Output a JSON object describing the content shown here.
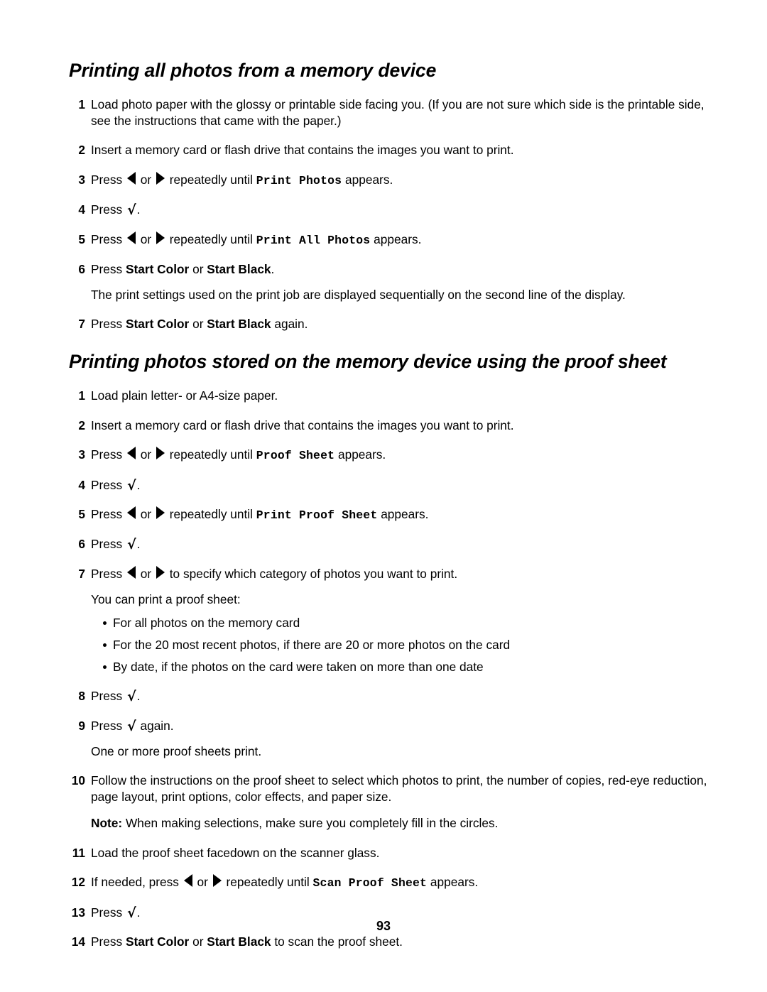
{
  "document": {
    "page_number": "93",
    "sections": [
      {
        "heading": "Printing all photos from a memory device",
        "steps": [
          {
            "num": "1",
            "parts": [
              {
                "t": "text",
                "v": "Load photo paper with the glossy or printable side facing you. (If you are not sure which side is the printable side, see the instructions that came with the paper.)"
              }
            ]
          },
          {
            "num": "2",
            "parts": [
              {
                "t": "text",
                "v": "Insert a memory card or flash drive that contains the images you want to print."
              }
            ]
          },
          {
            "num": "3",
            "parts": [
              {
                "t": "text",
                "v": "Press "
              },
              {
                "t": "icon",
                "v": "arrow-left"
              },
              {
                "t": "text",
                "v": " or "
              },
              {
                "t": "icon",
                "v": "arrow-right"
              },
              {
                "t": "text",
                "v": " repeatedly until "
              },
              {
                "t": "lcd",
                "v": "Print Photos"
              },
              {
                "t": "text",
                "v": " appears."
              }
            ]
          },
          {
            "num": "4",
            "parts": [
              {
                "t": "text",
                "v": "Press "
              },
              {
                "t": "icon",
                "v": "checkmark"
              },
              {
                "t": "text",
                "v": "."
              }
            ]
          },
          {
            "num": "5",
            "parts": [
              {
                "t": "text",
                "v": "Press "
              },
              {
                "t": "icon",
                "v": "arrow-left"
              },
              {
                "t": "text",
                "v": " or "
              },
              {
                "t": "icon",
                "v": "arrow-right"
              },
              {
                "t": "text",
                "v": " repeatedly until "
              },
              {
                "t": "lcd",
                "v": "Print All Photos"
              },
              {
                "t": "text",
                "v": " appears."
              }
            ]
          },
          {
            "num": "6",
            "parts": [
              {
                "t": "text",
                "v": "Press "
              },
              {
                "t": "btn",
                "v": "Start Color"
              },
              {
                "t": "text",
                "v": " or "
              },
              {
                "t": "btn",
                "v": "Start Black"
              },
              {
                "t": "text",
                "v": "."
              },
              {
                "t": "para",
                "v": "The print settings used on the print job are displayed sequentially on the second line of the display."
              }
            ]
          },
          {
            "num": "7",
            "parts": [
              {
                "t": "text",
                "v": "Press "
              },
              {
                "t": "btn",
                "v": "Start Color"
              },
              {
                "t": "text",
                "v": " or "
              },
              {
                "t": "btn",
                "v": "Start Black"
              },
              {
                "t": "text",
                "v": " again."
              }
            ]
          }
        ]
      },
      {
        "heading": "Printing photos stored on the memory device using the proof sheet",
        "steps": [
          {
            "num": "1",
            "parts": [
              {
                "t": "text",
                "v": "Load plain letter- or A4-size paper."
              }
            ]
          },
          {
            "num": "2",
            "parts": [
              {
                "t": "text",
                "v": "Insert a memory card or flash drive that contains the images you want to print."
              }
            ]
          },
          {
            "num": "3",
            "parts": [
              {
                "t": "text",
                "v": "Press "
              },
              {
                "t": "icon",
                "v": "arrow-left"
              },
              {
                "t": "text",
                "v": " or "
              },
              {
                "t": "icon",
                "v": "arrow-right"
              },
              {
                "t": "text",
                "v": " repeatedly until "
              },
              {
                "t": "lcd",
                "v": "Proof Sheet"
              },
              {
                "t": "text",
                "v": " appears."
              }
            ]
          },
          {
            "num": "4",
            "parts": [
              {
                "t": "text",
                "v": "Press "
              },
              {
                "t": "icon",
                "v": "checkmark"
              },
              {
                "t": "text",
                "v": "."
              }
            ]
          },
          {
            "num": "5",
            "parts": [
              {
                "t": "text",
                "v": "Press "
              },
              {
                "t": "icon",
                "v": "arrow-left"
              },
              {
                "t": "text",
                "v": " or "
              },
              {
                "t": "icon",
                "v": "arrow-right"
              },
              {
                "t": "text",
                "v": " repeatedly until "
              },
              {
                "t": "lcd",
                "v": "Print Proof Sheet"
              },
              {
                "t": "text",
                "v": " appears."
              }
            ]
          },
          {
            "num": "6",
            "parts": [
              {
                "t": "text",
                "v": "Press "
              },
              {
                "t": "icon",
                "v": "checkmark"
              },
              {
                "t": "text",
                "v": "."
              }
            ]
          },
          {
            "num": "7",
            "parts": [
              {
                "t": "text",
                "v": "Press "
              },
              {
                "t": "icon",
                "v": "arrow-left"
              },
              {
                "t": "text",
                "v": " or "
              },
              {
                "t": "icon",
                "v": "arrow-right"
              },
              {
                "t": "text",
                "v": " to specify which category of photos you want to print."
              },
              {
                "t": "para",
                "v": "You can print a proof sheet:"
              },
              {
                "t": "bullets",
                "v": [
                  "For all photos on the memory card",
                  "For the 20 most recent photos, if there are 20 or more photos on the card",
                  "By date, if the photos on the card were taken on more than one date"
                ]
              }
            ]
          },
          {
            "num": "8",
            "parts": [
              {
                "t": "text",
                "v": "Press "
              },
              {
                "t": "icon",
                "v": "checkmark"
              },
              {
                "t": "text",
                "v": "."
              }
            ]
          },
          {
            "num": "9",
            "parts": [
              {
                "t": "text",
                "v": "Press "
              },
              {
                "t": "icon",
                "v": "checkmark"
              },
              {
                "t": "text",
                "v": " again."
              },
              {
                "t": "para",
                "v": "One or more proof sheets print."
              }
            ]
          },
          {
            "num": "10",
            "parts": [
              {
                "t": "text",
                "v": "Follow the instructions on the proof sheet to select which photos to print, the number of copies, red-eye reduction, page layout, print options, color effects, and paper size."
              },
              {
                "t": "note",
                "label": "Note:",
                "v": " When making selections, make sure you completely fill in the circles."
              }
            ]
          },
          {
            "num": "11",
            "parts": [
              {
                "t": "text",
                "v": "Load the proof sheet facedown on the scanner glass."
              }
            ]
          },
          {
            "num": "12",
            "parts": [
              {
                "t": "text",
                "v": "If needed, press "
              },
              {
                "t": "icon",
                "v": "arrow-left"
              },
              {
                "t": "text",
                "v": " or "
              },
              {
                "t": "icon",
                "v": "arrow-right"
              },
              {
                "t": "text",
                "v": " repeatedly until "
              },
              {
                "t": "lcd",
                "v": "Scan Proof Sheet"
              },
              {
                "t": "text",
                "v": " appears."
              }
            ]
          },
          {
            "num": "13",
            "parts": [
              {
                "t": "text",
                "v": "Press "
              },
              {
                "t": "icon",
                "v": "checkmark"
              },
              {
                "t": "text",
                "v": "."
              }
            ]
          },
          {
            "num": "14",
            "parts": [
              {
                "t": "text",
                "v": "Press "
              },
              {
                "t": "btn",
                "v": "Start Color"
              },
              {
                "t": "text",
                "v": " or "
              },
              {
                "t": "btn",
                "v": "Start Black"
              },
              {
                "t": "text",
                "v": " to scan the proof sheet."
              }
            ]
          }
        ]
      }
    ],
    "icons": {
      "checkmark": "√"
    }
  }
}
